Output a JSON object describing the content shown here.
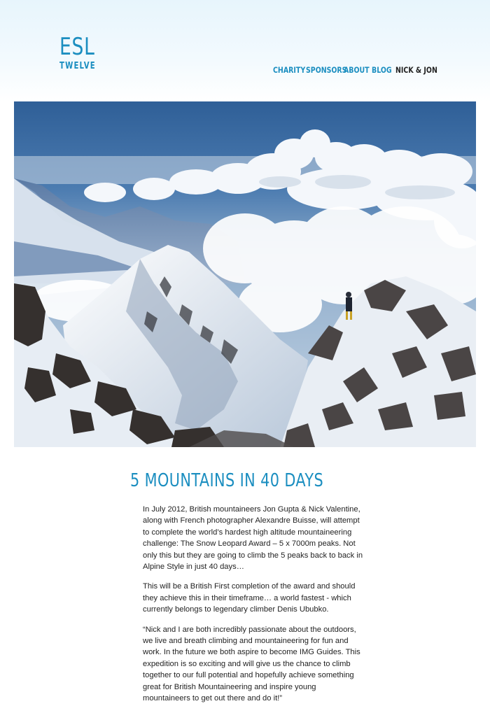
{
  "logo": {
    "main": "ESL",
    "sub": "TWELVE"
  },
  "nav": [
    {
      "label": "CHARITY",
      "name": "nav-charity"
    },
    {
      "label": "SPONSORS",
      "name": "nav-sponsors"
    },
    {
      "label": "ABOUT",
      "name": "nav-about"
    },
    {
      "label": "BLOG",
      "name": "nav-blog"
    },
    {
      "label": "NICK & JON",
      "name": "nav-nick-jon"
    }
  ],
  "colors": {
    "accent": "#1b8ec0",
    "text": "#222222",
    "header_bg": "#e7f5fc"
  },
  "hero": {
    "image": "mountain-summit-ridge-photo"
  },
  "article": {
    "title": "5 MOUNTAINS IN 40 DAYS",
    "paragraphs": [
      "In July 2012, British mountaineers Jon Gupta & Nick Valentine, along with French photographer Alexandre Buisse, will attempt to complete the world’s hardest high altitude mountaineering challenge: The Snow Leopard Award – 5 x 7000m peaks. Not only this but they are going to climb the 5 peaks back to back in Alpine Style in just 40 days…",
      "This will be a British First completion of the award and should they achieve this in their timeframe… a world fastest - which currently belongs to legendary climber Denis Ububko.",
      "“Nick and I are both incredibly passionate about the outdoors, we live and breath climbing and mountaineering for fun and work. In the future we both aspire to become IMG Guides. This expedition is so exciting and will give us the chance to climb together to our full potential and hopefully achieve something great for British Mountaineering and inspire young mountaineers to get out there and do it!”"
    ]
  }
}
